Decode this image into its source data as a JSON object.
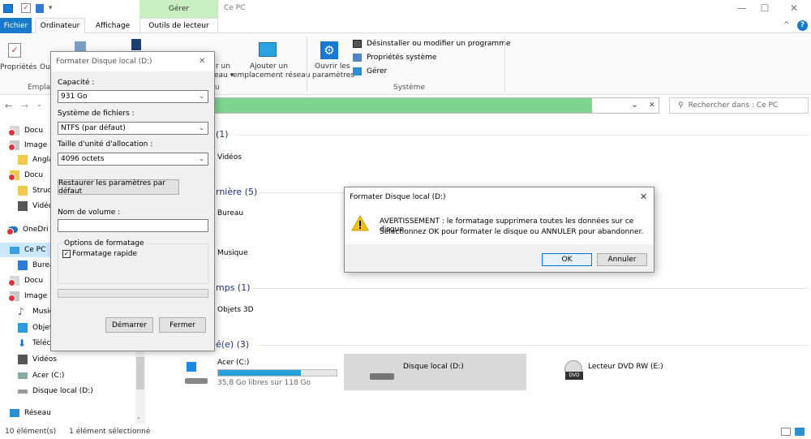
{
  "window": {
    "title": "Ce PC",
    "manage_tab": "Gérer",
    "minimize": "—",
    "maximize": "☐",
    "close": "✕"
  },
  "ribbon_tabs": [
    "Fichier",
    "Ordinateur",
    "Affichage",
    "Outils de lecteur"
  ],
  "ribbon": {
    "proprietes": "Propriétés",
    "ou": "Ou",
    "empla": "Empla",
    "r_un": "r un",
    "eau": "eau ▾",
    "u": "u",
    "ajouter_line1": "Ajouter un",
    "ajouter_line2": "emplacement réseau",
    "ouvrir_line1": "Ouvrir les",
    "ouvrir_line2": "paramètres",
    "desinstaller": "Désinstaller ou modifier un programme",
    "proprietes_systeme": "Propriétés système",
    "gerer": "Gérer",
    "group_systeme": "Système",
    "help": "?",
    "collapse": "^"
  },
  "address": {
    "dropdown": "⌄",
    "clear": "✕",
    "search_placeholder": "Rechercher dans : Ce PC"
  },
  "nav": {
    "items": [
      {
        "label": "Docu"
      },
      {
        "label": "Image"
      },
      {
        "label": "Angla"
      },
      {
        "label": "Docu"
      },
      {
        "label": "Struct"
      },
      {
        "label": "Vidéo"
      },
      {
        "label": "OneDri"
      },
      {
        "label": "Ce PC"
      },
      {
        "label": "Burea"
      },
      {
        "label": "Docu"
      },
      {
        "label": "Image"
      },
      {
        "label": "Music"
      },
      {
        "label": "Objet"
      },
      {
        "label": "Téléc"
      },
      {
        "label": "Vidéos"
      },
      {
        "label": "Acer (C:)"
      },
      {
        "label": "Disque local (D:)"
      },
      {
        "label": "Réseau"
      }
    ]
  },
  "content": {
    "sec1": "(1)",
    "sec1_item": "Vidéos",
    "sec2": "rnière (5)",
    "sec2_item1": "Bureau",
    "sec2_item2": "Musique",
    "sec3": "mps (1)",
    "sec3_item": "Objets 3D",
    "sec4": "é(e) (3)",
    "drive_c_name": "Acer (C:)",
    "drive_c_free": "35,8 Go libres sur 118 Go",
    "drive_c_used_fraction": 0.7,
    "drive_d_name": "Disque local (D:)",
    "drive_e_name": "Lecteur DVD RW (E:)",
    "dvd_badge": "DVD"
  },
  "status": {
    "count": "10 élément(s)",
    "selected": "1 élément sélectionné"
  },
  "format_dialog": {
    "title": "Formater Disque local (D:)",
    "close": "✕",
    "capacity_label": "Capacité :",
    "capacity_value": "931 Go",
    "fs_label": "Système de fichiers :",
    "fs_value": "NTFS (par défaut)",
    "alloc_label": "Taille d'unité d'allocation :",
    "alloc_value": "4096 octets",
    "restore_button": "Restaurer les paramètres par défaut",
    "volume_label": "Nom de volume :",
    "volume_value": "",
    "options_label": "Options de formatage",
    "quick_format": "Formatage rapide",
    "start_button": "Démarrer",
    "close_button": "Fermer"
  },
  "warn_dialog": {
    "title": "Formater Disque local (D:)",
    "close": "✕",
    "line1": "AVERTISSEMENT : le formatage supprimera toutes les données sur ce disque.",
    "line2": "Sélectionnez OK pour formater le disque ou ANNULER pour abandonner.",
    "ok": "OK",
    "cancel": "Annuler"
  }
}
